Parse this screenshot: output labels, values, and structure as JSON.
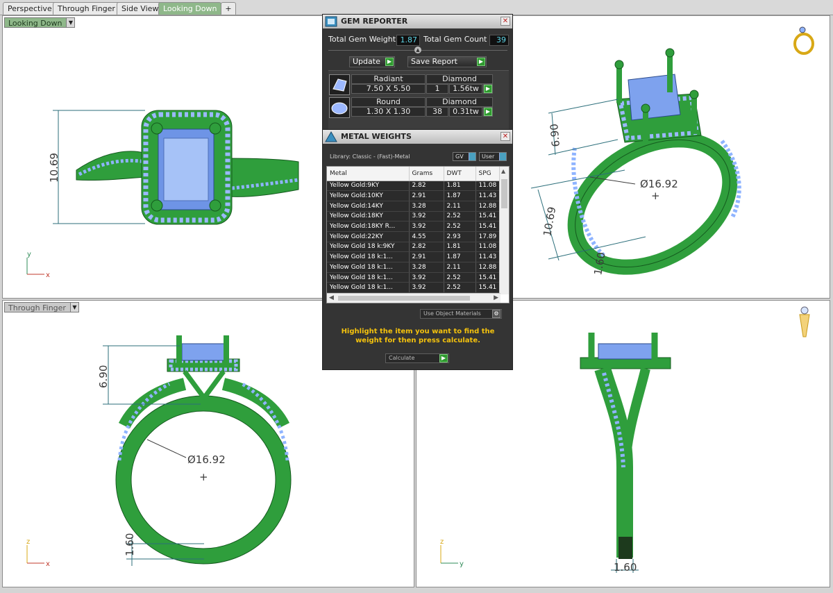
{
  "tabs": [
    {
      "label": "Perspective"
    },
    {
      "label": "Through Finger"
    },
    {
      "label": "Side View"
    },
    {
      "label": "Looking Down",
      "active": true
    },
    {
      "label": "+"
    }
  ],
  "viewports": {
    "top_left": {
      "label": "Looking Down",
      "dim_height": "10.69",
      "axis_v": "y",
      "axis_h": "x"
    },
    "top_right": {
      "dim_a": "6.90",
      "dim_b": "10.69",
      "dim_c": "1.60",
      "diameter": "Ø16.92"
    },
    "bottom_left": {
      "label": "Through Finger",
      "dim_top": "6.90",
      "dim_bottom": "1.60",
      "diameter": "Ø16.92",
      "axis_v": "z",
      "axis_h": "x"
    },
    "bottom_right": {
      "dim_width": "1.60",
      "axis_v": "z",
      "axis_h": "y"
    }
  },
  "gem_reporter": {
    "title": "GEM REPORTER",
    "total_weight_label": "Total Gem Weight",
    "total_weight": "1.87",
    "total_count_label": "Total Gem Count",
    "total_count": "39",
    "update_label": "Update",
    "save_label": "Save Report",
    "gems": [
      {
        "shape": "Radiant",
        "type": "Diamond",
        "size": "7.50 X 5.50",
        "count": "1",
        "weight": "1.56tw"
      },
      {
        "shape": "Round",
        "type": "Diamond",
        "size": "1.30 X 1.30",
        "count": "38",
        "weight": "0.31tw"
      }
    ]
  },
  "metal_weights": {
    "title": "METAL WEIGHTS",
    "library": "Library: Classic - (Fast)-Metal",
    "gv_label": "GV",
    "user_label": "User",
    "columns": [
      "Metal",
      "Grams",
      "DWT",
      "SPG"
    ],
    "rows": [
      [
        "Yellow Gold:9KY",
        "2.82",
        "1.81",
        "11.08"
      ],
      [
        "Yellow Gold:10KY",
        "2.91",
        "1.87",
        "11.43"
      ],
      [
        "Yellow Gold:14KY",
        "3.28",
        "2.11",
        "12.88"
      ],
      [
        "Yellow Gold:18KY",
        "3.92",
        "2.52",
        "15.41"
      ],
      [
        "Yellow Gold:18KY R...",
        "3.92",
        "2.52",
        "15.41"
      ],
      [
        "Yellow Gold:22KY",
        "4.55",
        "2.93",
        "17.89"
      ],
      [
        "Yellow Gold 18 k:9KY",
        "2.82",
        "1.81",
        "11.08"
      ],
      [
        "Yellow Gold 18 k:1...",
        "2.91",
        "1.87",
        "11.43"
      ],
      [
        "Yellow Gold 18 k:1...",
        "3.28",
        "2.11",
        "12.88"
      ],
      [
        "Yellow Gold 18 k:1...",
        "3.92",
        "2.52",
        "15.41"
      ],
      [
        "Yellow Gold 18 k:1...",
        "3.92",
        "2.52",
        "15.41"
      ]
    ],
    "use_object_materials": "Use Object Materials",
    "message": "Highlight the item you want to find the weight for then press calculate.",
    "calculate_label": "Calculate"
  }
}
